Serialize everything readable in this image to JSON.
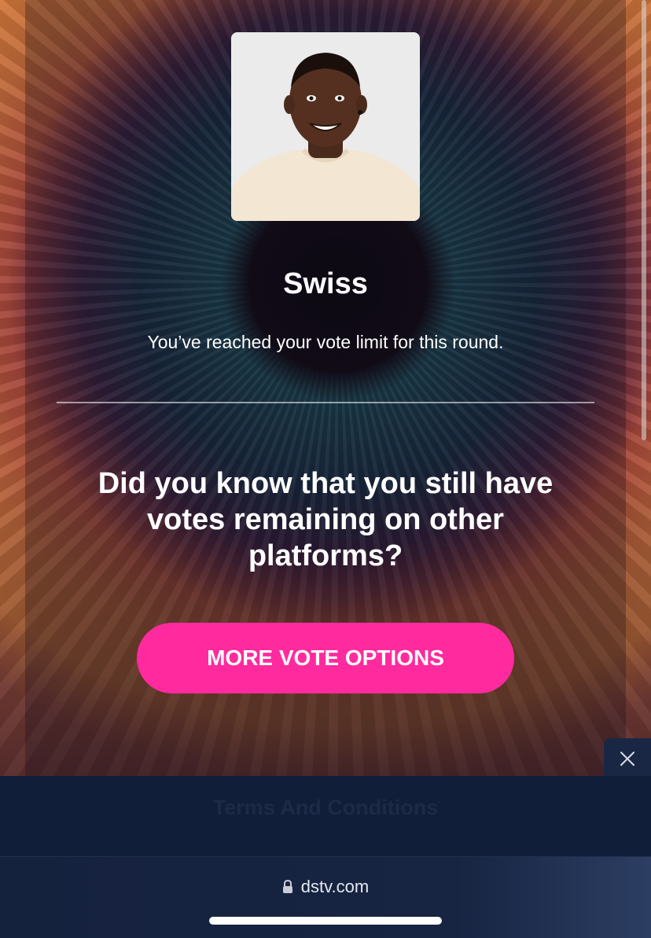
{
  "contestant": {
    "name": "Swiss",
    "photo_icon": "contestant-portrait"
  },
  "status": {
    "vote_limit_message": "You’ve reached your vote limit for this round."
  },
  "prompt": {
    "question": "Did you know that you still have votes remaining on other platforms?"
  },
  "actions": {
    "more_vote_options_label": "MORE VOTE OPTIONS",
    "accent_color": "#ff2b9e"
  },
  "sheet": {
    "terms_label": "Terms And Conditions",
    "close_icon": "close-icon"
  },
  "browser": {
    "url": "dstv.com",
    "lock_icon": "lock-icon"
  }
}
